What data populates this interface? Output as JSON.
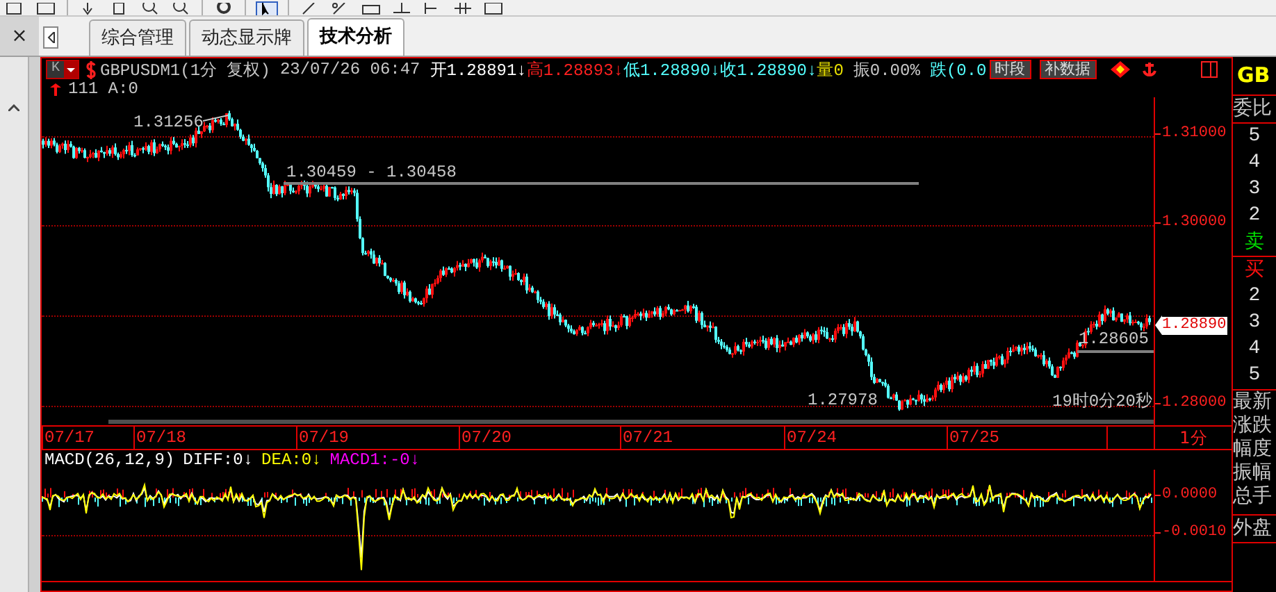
{
  "close_label": "×",
  "tabs": [
    {
      "label": "综合管理",
      "selected": false
    },
    {
      "label": "动态显示牌",
      "selected": false
    },
    {
      "label": "技术分析",
      "selected": true
    }
  ],
  "chart": {
    "symbol": "GBPUSDM1(1分 复权)",
    "datetime": "23/07/26 06:47",
    "quote_items": [
      {
        "label": "开",
        "value": "1.28891",
        "arrow": "↓",
        "color": "#ffffff"
      },
      {
        "label": "高",
        "value": "1.28893",
        "arrow": "↓",
        "color": "#ff2020"
      },
      {
        "label": "低",
        "value": "1.28890",
        "arrow": "↓",
        "color": "#54ffff"
      },
      {
        "label": "收",
        "value": "1.28890",
        "arrow": "↓",
        "color": "#54ffff"
      },
      {
        "label": "量",
        "value": "0",
        "color": "#e8e000"
      },
      {
        "label": "振",
        "value": "0.00%",
        "color": "#c8c8c8"
      },
      {
        "label": "跌",
        "value": "(0.0",
        "color": "#54ffff"
      }
    ],
    "period_button": "K",
    "buttons": [
      "时段",
      "补数据"
    ],
    "info": "111 A:0",
    "annotations": [
      {
        "text": "1.31256"
      },
      {
        "text": "1.30459 - 1.30458"
      },
      {
        "text": "1.28605"
      },
      {
        "text": "1.27978"
      },
      {
        "text": "19时0分20秒"
      }
    ],
    "price_ticks": [
      "1.31000",
      "1.30000",
      "1.28000"
    ],
    "last_price": "1.28890",
    "dates": [
      "07/17",
      "07/18",
      "07/19",
      "07/20",
      "07/21",
      "07/24",
      "07/25"
    ],
    "period": "1分",
    "indicator": [
      {
        "text": "MACD(26,12,9)",
        "color": "#ffffff"
      },
      {
        "text": "DIFF:0",
        "arrow": "↓",
        "color": "#ffffff"
      },
      {
        "text": "DEA:0",
        "arrow": "↓",
        "color": "#ffff00"
      },
      {
        "text": "MACD1:-0",
        "arrow": "↓",
        "color": "#ff00ff"
      }
    ],
    "indicator_ticks": [
      "0.0000",
      "-0.0010"
    ]
  },
  "quote_panel": {
    "header": "GB",
    "rows": [
      {
        "kind": "title",
        "text": "委比"
      },
      {
        "kind": "level",
        "text": "5"
      },
      {
        "kind": "level",
        "text": "4"
      },
      {
        "kind": "level",
        "text": "3"
      },
      {
        "kind": "level",
        "text": "2"
      },
      {
        "kind": "sell",
        "text": "卖"
      },
      {
        "kind": "buy",
        "text": "买"
      },
      {
        "kind": "level",
        "text": "2"
      },
      {
        "kind": "level",
        "text": "3"
      },
      {
        "kind": "level",
        "text": "4"
      },
      {
        "kind": "level",
        "text": "5"
      },
      {
        "kind": "field",
        "text": "最新"
      },
      {
        "kind": "field",
        "text": "涨跌"
      },
      {
        "kind": "field",
        "text": "幅度"
      },
      {
        "kind": "field",
        "text": "振幅"
      },
      {
        "kind": "field",
        "text": "总手"
      },
      {
        "kind": "title",
        "text": "外盘"
      }
    ]
  }
}
